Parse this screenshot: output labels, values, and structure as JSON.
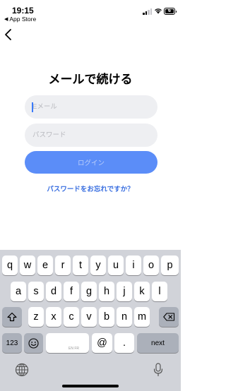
{
  "status_bar": {
    "time": "19:15",
    "back_app": "App Store",
    "battery": "6"
  },
  "nav": {
    "back_icon": "chevron-left-icon"
  },
  "title": "メールで続ける",
  "email": {
    "placeholder": "Eメール",
    "value": ""
  },
  "password": {
    "placeholder": "パスワード",
    "value": ""
  },
  "login_button": {
    "label": "ログイン"
  },
  "forgot_link": {
    "label": "パスワードをお忘れですか？"
  },
  "keyboard": {
    "row1": [
      "q",
      "w",
      "e",
      "r",
      "t",
      "y",
      "u",
      "i",
      "o",
      "p"
    ],
    "row2": [
      "a",
      "s",
      "d",
      "f",
      "g",
      "h",
      "j",
      "k",
      "l"
    ],
    "row3": [
      "z",
      "x",
      "c",
      "v",
      "b",
      "n",
      "m"
    ],
    "numbers_label": "123",
    "space_hint": "EN FR",
    "at": "@",
    "dot": ".",
    "next_label": "next"
  },
  "colors": {
    "accent": "#5b8df8",
    "link": "#3a6fe0",
    "field_bg": "#eeeff2",
    "keyboard_bg": "#d1d3d9"
  }
}
